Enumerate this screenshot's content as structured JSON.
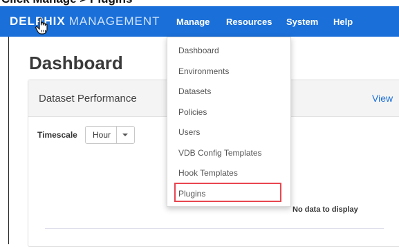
{
  "caption": "Click Manage > Plugins",
  "navbar": {
    "brand_bold": "DELPHIX",
    "brand_light": "MANAGEMENT",
    "items": [
      "Manage",
      "Resources",
      "System",
      "Help"
    ]
  },
  "page": {
    "title": "Dashboard"
  },
  "panel": {
    "title": "Dataset Performance",
    "link": "View",
    "timescale_label": "Timescale",
    "timescale_value": "Hour",
    "no_data": "No data to display"
  },
  "manage_menu": {
    "items": [
      "Dashboard",
      "Environments",
      "Datasets",
      "Policies",
      "Users",
      "VDB Config Templates",
      "Hook Templates",
      "Plugins"
    ],
    "highlighted": "Plugins"
  },
  "colors": {
    "navbar": "#1a6fd8",
    "highlight": "#e8464f"
  },
  "icons": [
    "hand-pointer-icon",
    "caret-down-icon"
  ]
}
